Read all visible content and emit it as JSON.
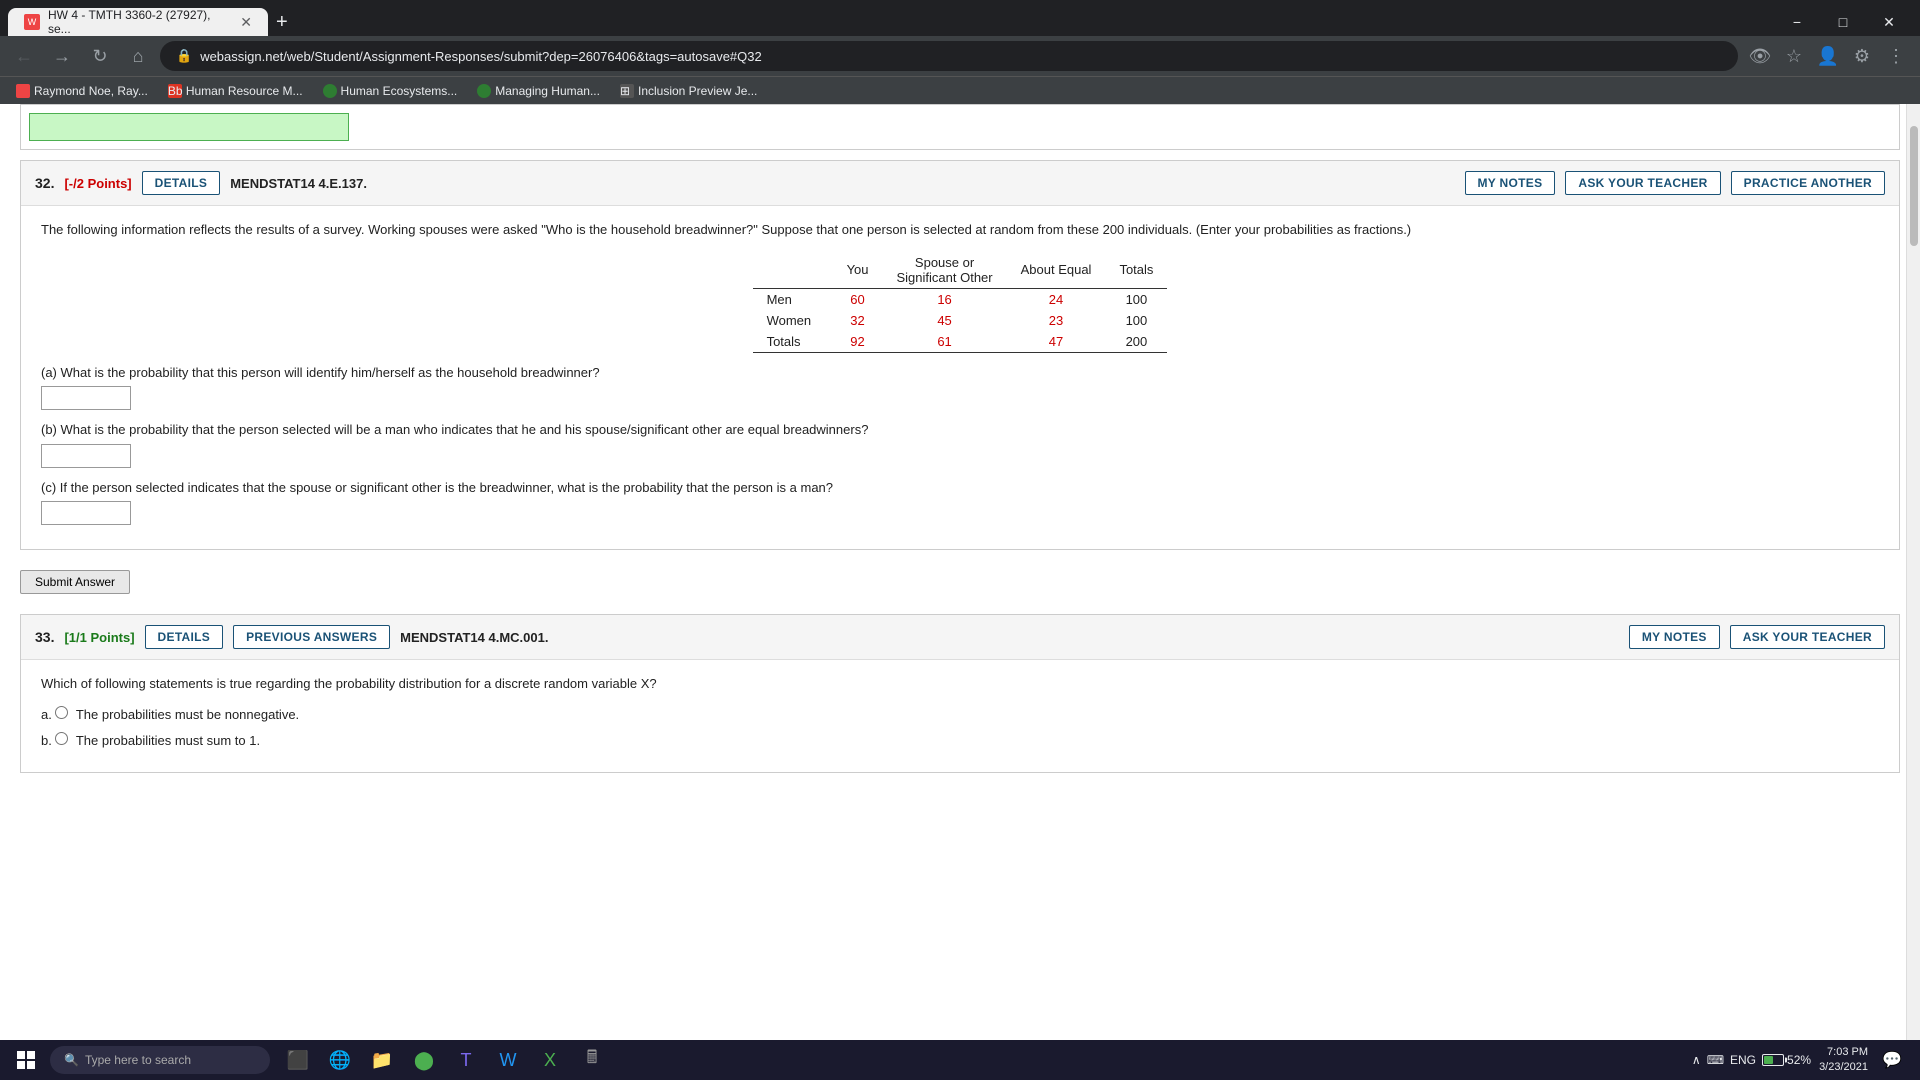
{
  "browser": {
    "tab_label": "HW 4 - TMTH 3360-2 (27927), se...",
    "address": "webassign.net/web/Student/Assignment-Responses/submit?dep=26076406&tags=autosave#Q32",
    "bookmarks": [
      {
        "label": "Raymond Noe, Ray...",
        "color": "#e44"
      },
      {
        "label": "Human Resource M...",
        "color": "#1565c0"
      },
      {
        "label": "Human Ecosystems...",
        "color": "#2e7d32"
      },
      {
        "label": "Managing Human...",
        "color": "#2e7d32"
      },
      {
        "label": "Inclusion Preview Je...",
        "color": "#555"
      }
    ],
    "window_controls": [
      "−",
      "□",
      "✕"
    ]
  },
  "q32": {
    "num": "32.",
    "points": "[-/2 Points]",
    "btn_details": "DETAILS",
    "btn_notes": "MY NOTES",
    "btn_ask_teacher": "ASK YOUR TEACHER",
    "btn_practice": "PRACTICE ANOTHER",
    "problem_code": "MENDSTAT14 4.E.137.",
    "question_text": "The following information reflects the results of a survey. Working spouses were asked \"Who is the household breadwinner?\" Suppose that one person is selected at random from these 200 individuals. (Enter your probabilities as fractions.)",
    "table": {
      "headers": [
        "",
        "You",
        "Spouse or\nSignificant Other",
        "About Equal",
        "Totals"
      ],
      "rows": [
        {
          "label": "Men",
          "you": "60",
          "spouse": "16",
          "equal": "24",
          "total": "100"
        },
        {
          "label": "Women",
          "you": "32",
          "spouse": "45",
          "equal": "23",
          "total": "100"
        },
        {
          "label": "Totals",
          "you": "92",
          "spouse": "61",
          "equal": "47",
          "total": "200"
        }
      ]
    },
    "part_a_label": "(a) What is the probability that this person will identify him/herself as the household breadwinner?",
    "part_b_label": "(b) What is the probability that the person selected will be a man who indicates that he and his spouse/significant other are equal breadwinners?",
    "part_c_label": "(c) If the person selected indicates that the spouse or significant other is the breadwinner, what is the probability that the person is a man?",
    "submit_btn": "Submit Answer"
  },
  "q33": {
    "num": "33.",
    "points": "[1/1 Points]",
    "btn_details": "DETAILS",
    "btn_prev_answers": "PREVIOUS ANSWERS",
    "btn_notes": "MY NOTES",
    "btn_ask_teacher": "ASK YOUR TEACHER",
    "problem_code": "MENDSTAT14 4.MC.001.",
    "question_text": "Which of following statements is true regarding the probability distribution for a discrete random variable X?",
    "option_a": "a.  ○ The probabilities must be nonnegative.",
    "option_b": "b.  ○ The probabilities must sum to 1."
  },
  "taskbar": {
    "search_placeholder": "Type here to search",
    "time": "7:03 PM",
    "date": "3/23/2021",
    "battery": "52%",
    "lang": "ENG"
  }
}
